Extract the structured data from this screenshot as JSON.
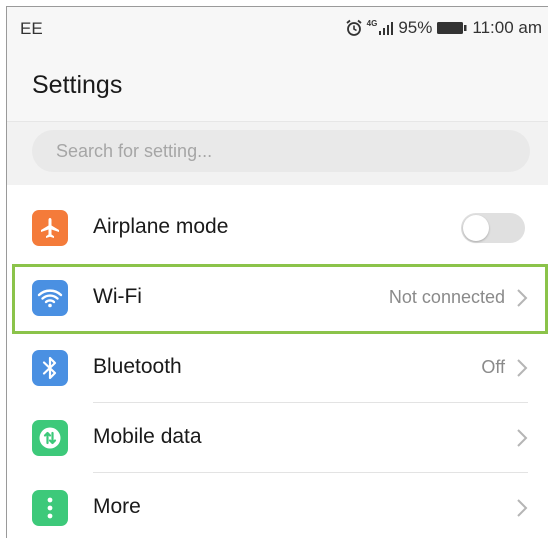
{
  "status_bar": {
    "carrier": "EE",
    "network_type": "4G",
    "battery_percent": "95%",
    "time": "11:00 am",
    "icons": [
      "alarm-icon",
      "signal-icon",
      "battery-icon"
    ]
  },
  "header": {
    "title": "Settings"
  },
  "search": {
    "placeholder": "Search for setting..."
  },
  "settings": [
    {
      "label": "Airplane mode",
      "icon": "airplane-icon",
      "icon_color": "#f47b3a",
      "control": "toggle",
      "toggle_on": false,
      "value": ""
    },
    {
      "label": "Wi-Fi",
      "icon": "wifi-icon",
      "icon_color": "#4a90e2",
      "control": "chevron",
      "value": "Not connected",
      "highlighted": true
    },
    {
      "label": "Bluetooth",
      "icon": "bluetooth-icon",
      "icon_color": "#4a90e2",
      "control": "chevron",
      "value": "Off"
    },
    {
      "label": "Mobile data",
      "icon": "mobile-data-icon",
      "icon_color": "#3dc97a",
      "control": "chevron",
      "value": ""
    },
    {
      "label": "More",
      "icon": "more-icon",
      "icon_color": "#3dc97a",
      "control": "chevron",
      "value": ""
    }
  ],
  "colors": {
    "highlight": "#8bc34a",
    "background_gray": "#f7f7f7"
  }
}
